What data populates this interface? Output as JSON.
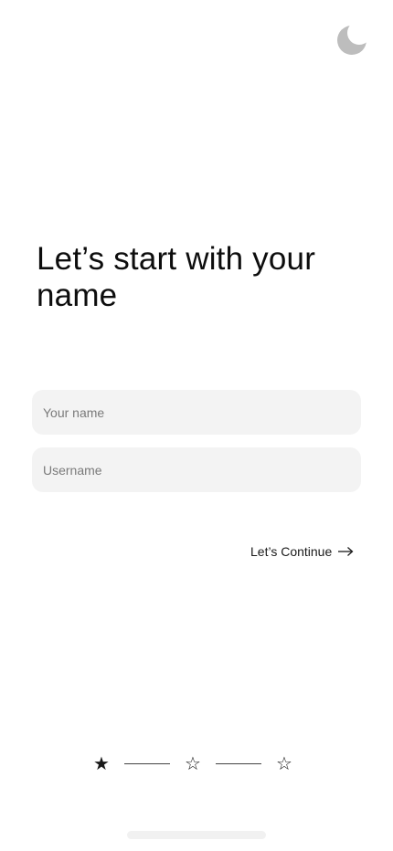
{
  "header": {
    "theme_toggle_icon": "moon-icon",
    "icon_color": "#bdbdbd"
  },
  "onboarding": {
    "title": "Let’s start with your name",
    "fields": {
      "name_placeholder": "Your name",
      "name_value": "",
      "username_placeholder": "Username",
      "username_value": ""
    },
    "continue_label": "Let’s Continue",
    "continue_icon": "arrow-right-icon"
  },
  "progress": {
    "current_step": 1,
    "total_steps": 3,
    "steps": [
      {
        "icon": "star-filled-icon",
        "glyph": "★"
      },
      {
        "icon": "star-outline-icon",
        "glyph": "☆"
      },
      {
        "icon": "star-outline-icon",
        "glyph": "☆"
      }
    ]
  },
  "colors": {
    "field_background": "#f3f3f3",
    "text": "#111111",
    "placeholder": "#7a7a7a",
    "home_indicator": "#f1f1f1"
  }
}
